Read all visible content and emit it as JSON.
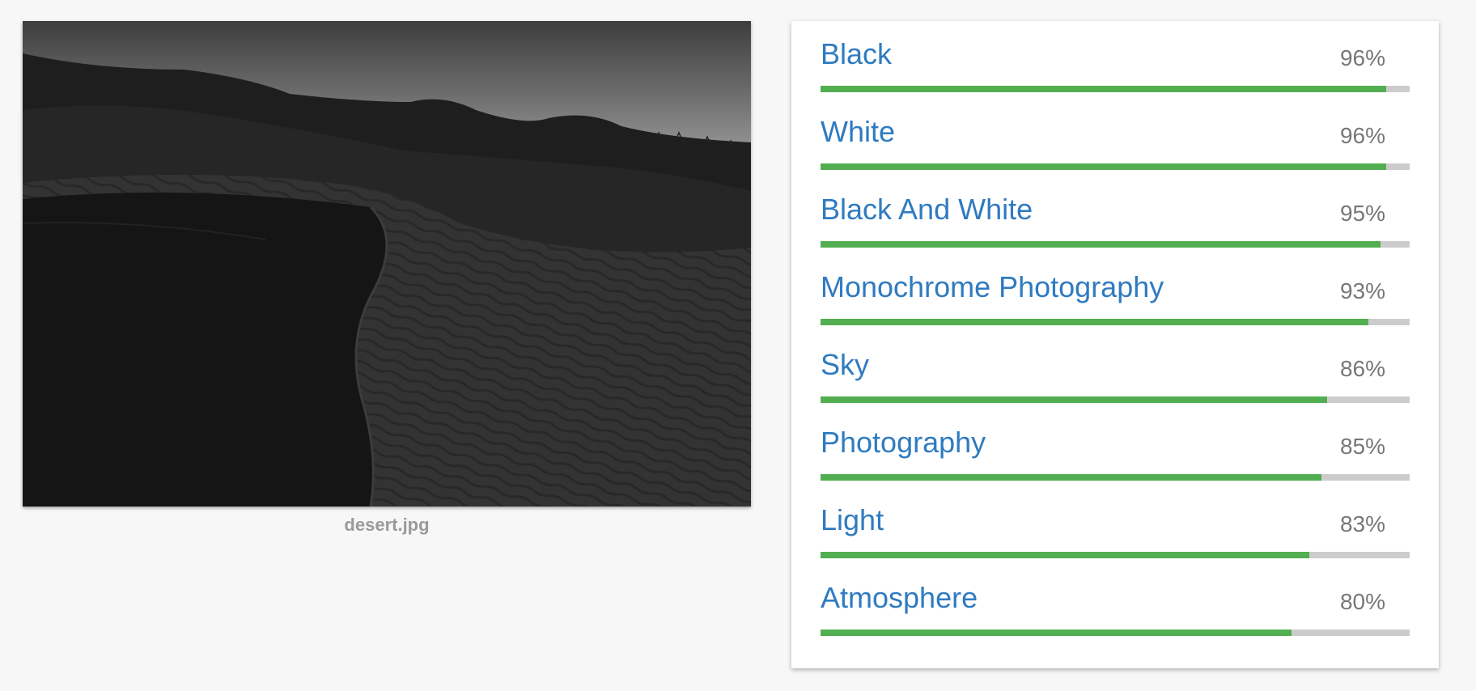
{
  "image": {
    "filename": "desert.jpg",
    "alt": "black and white desert dunes"
  },
  "colors": {
    "background": "#f7f7f7",
    "card": "#ffffff",
    "label_text": "#2f7bc0",
    "score_text": "#777777",
    "bar_fill": "#52ae50",
    "bar_track": "#cccccc",
    "caption_text": "#9a9a9a"
  },
  "labels": [
    {
      "name": "Black",
      "score": "96%",
      "fraction": 0.96
    },
    {
      "name": "White",
      "score": "96%",
      "fraction": 0.96
    },
    {
      "name": "Black And White",
      "score": "95%",
      "fraction": 0.95
    },
    {
      "name": "Monochrome Photography",
      "score": "93%",
      "fraction": 0.93
    },
    {
      "name": "Sky",
      "score": "86%",
      "fraction": 0.86
    },
    {
      "name": "Photography",
      "score": "85%",
      "fraction": 0.85
    },
    {
      "name": "Light",
      "score": "83%",
      "fraction": 0.83
    },
    {
      "name": "Atmosphere",
      "score": "80%",
      "fraction": 0.8
    }
  ]
}
